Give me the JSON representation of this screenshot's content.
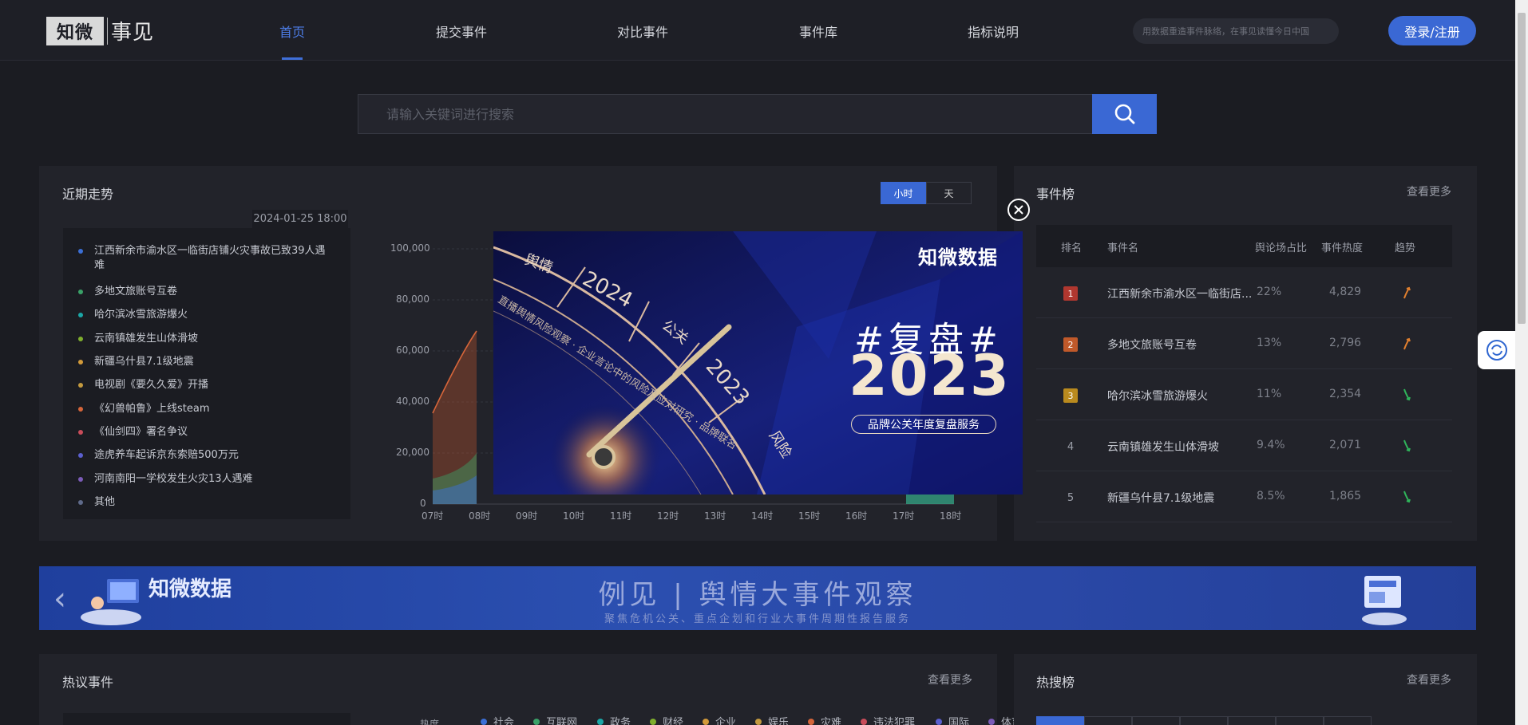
{
  "header": {
    "logo_box": "知微",
    "logo_text": "事见",
    "nav": [
      "首页",
      "提交事件",
      "对比事件",
      "事件库",
      "指标说明"
    ],
    "search_placeholder": "用数据重造事件脉络，在事见读懂今日中国",
    "login": "登录/注册"
  },
  "search": {
    "placeholder": "请输入关键词进行搜索"
  },
  "trend": {
    "title": "近期走势",
    "toggle": [
      "小时",
      "天"
    ],
    "date": "2024-01-25 18:00",
    "legend": [
      {
        "label": "江西新余市渝水区一临街店铺火灾事故已致39人遇难",
        "color": "#3b6fd6"
      },
      {
        "label": "多地文旅账号互卷",
        "color": "#3aa168"
      },
      {
        "label": "哈尔滨冰雪旅游爆火",
        "color": "#1ba7a7"
      },
      {
        "label": "云南镇雄发生山体滑坡",
        "color": "#7fae2d"
      },
      {
        "label": "新疆乌什县7.1级地震",
        "color": "#d29a3a"
      },
      {
        "label": "电视剧《要久久爱》开播",
        "color": "#c49a3f"
      },
      {
        "label": "《幻兽帕鲁》上线steam",
        "color": "#d5653a"
      },
      {
        "label": "《仙剑四》署名争议",
        "color": "#c94c5a"
      },
      {
        "label": "途虎养车起诉京东索赔500万元",
        "color": "#5b5fcf"
      },
      {
        "label": "河南南阳一学校发生火灾13人遇难",
        "color": "#7b5bb8"
      },
      {
        "label": "其他",
        "color": "#5f6a8a"
      }
    ],
    "y_ticks": [
      "100,000",
      "80,000",
      "60,000",
      "40,000",
      "20,000",
      "0"
    ],
    "x_ticks": [
      "07时",
      "08时",
      "09时",
      "10时",
      "11时",
      "12时",
      "13时",
      "14时",
      "15时",
      "16时",
      "17时",
      "18时"
    ]
  },
  "board": {
    "title": "事件榜",
    "more": "查看更多",
    "cols": [
      "排名",
      "事件名",
      "舆论场占比",
      "事件热度",
      "趋势"
    ],
    "rows": [
      {
        "rank": "1",
        "name": "江西新余市渝水区一临街店...",
        "share": "22%",
        "heat": "4,829",
        "trend": "up",
        "rank_color": "#b0372f"
      },
      {
        "rank": "2",
        "name": "多地文旅账号互卷",
        "share": "13%",
        "heat": "2,796",
        "trend": "up",
        "rank_color": "#c0592a"
      },
      {
        "rank": "3",
        "name": "哈尔滨冰雪旅游爆火",
        "share": "11%",
        "heat": "2,354",
        "trend": "down",
        "rank_color": "#b98a1e"
      },
      {
        "rank": "4",
        "name": "云南镇雄发生山体滑坡",
        "share": "9.4%",
        "heat": "2,071",
        "trend": "down",
        "rank_color": ""
      },
      {
        "rank": "5",
        "name": "新疆乌什县7.1级地震",
        "share": "8.5%",
        "heat": "1,865",
        "trend": "down",
        "rank_color": ""
      }
    ]
  },
  "banner": {
    "logo": "知微数据",
    "title": "例见 | 舆情大事件观察",
    "subtitle": "聚焦危机公关、重点企划和行业大事件周期性报告服务"
  },
  "hot_events": {
    "title": "热议事件",
    "more": "查看更多",
    "heat_label": "热度",
    "categories": [
      {
        "label": "社会",
        "color": "#3b6fd6"
      },
      {
        "label": "互联网",
        "color": "#3aa168"
      },
      {
        "label": "政务",
        "color": "#1ba7a7"
      },
      {
        "label": "财经",
        "color": "#7fae2d"
      },
      {
        "label": "企业",
        "color": "#d29a3a"
      },
      {
        "label": "娱乐",
        "color": "#c49a3f"
      },
      {
        "label": "灾难",
        "color": "#d5653a"
      },
      {
        "label": "违法犯罪",
        "color": "#c94c5a"
      },
      {
        "label": "国际",
        "color": "#5b5fcf"
      },
      {
        "label": "体育",
        "color": "#7b5bb8"
      }
    ]
  },
  "hot_search": {
    "title": "热搜榜",
    "more": "查看更多"
  },
  "popup": {
    "brand": "知微数据",
    "hash": "#复盘#",
    "year": "2023",
    "service": "品牌公关年度复盘服务",
    "dial_labels": [
      "舆情",
      "2024",
      "公关",
      "2023",
      "风险"
    ],
    "dial_text": "直播舆情风险观察 · 企业言论中的风险及应对研究 · 品牌联名"
  }
}
